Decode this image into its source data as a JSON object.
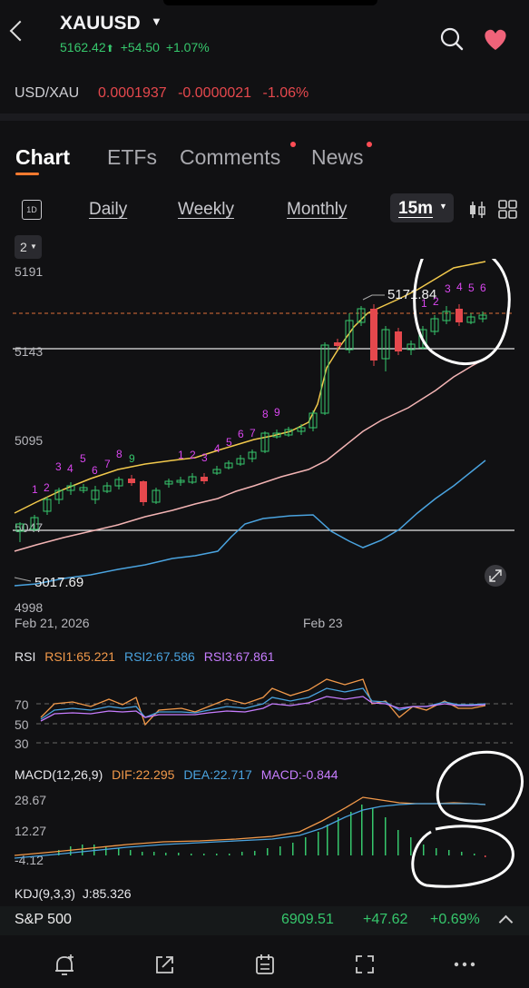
{
  "header": {
    "title": "XAUUSD",
    "price": "5162.42",
    "change": "+54.50",
    "change_pct": "+1.07%",
    "up_arrow": "⬆"
  },
  "pair": {
    "name": "USD/XAU",
    "price": "0.0001937",
    "change": "-0.0000021",
    "change_pct": "-1.06%"
  },
  "tabs": [
    {
      "label": "Chart",
      "active": true
    },
    {
      "label": "ETFs"
    },
    {
      "label": "Comments",
      "dot": true
    },
    {
      "label": "News",
      "dot": true
    }
  ],
  "periods": {
    "badge": "1D",
    "daily": "Daily",
    "weekly": "Weekly",
    "monthly": "Monthly",
    "selected": "15m"
  },
  "selector_value": "2",
  "price_axis": {
    "labels": [
      "5191",
      "5143",
      "5095",
      "5047",
      "4998"
    ]
  },
  "price_labels": {
    "high": "5171.84",
    "low": "5017.69"
  },
  "date_labels": [
    "Feb 21, 2026",
    "Feb 23"
  ],
  "seq_labels": {
    "s1": [
      "1",
      "2",
      "3",
      "4",
      "5",
      "6",
      "7",
      "8",
      "9"
    ],
    "s2": [
      "1",
      "2",
      "3",
      "4",
      "5",
      "6",
      "7",
      "8",
      "9"
    ],
    "s3": [
      "1",
      "2",
      "3",
      "4",
      "5",
      "6"
    ]
  },
  "rsi": {
    "title": "RSI",
    "rsi1": "RSI1:65.221",
    "rsi2": "RSI2:67.586",
    "rsi3": "RSI3:67.861",
    "levels": [
      "70",
      "50",
      "30"
    ]
  },
  "macd": {
    "title": "MACD(12,26,9)",
    "dif": "DIF:22.295",
    "dea": "DEA:22.717",
    "macd": "MACD:-0.844",
    "levels": [
      "28.67",
      "12.27",
      "-4.12"
    ]
  },
  "kdj": {
    "title": "KDJ(9,3,3)",
    "j": "J:85.326"
  },
  "ticker": {
    "name": "S&P 500",
    "price": "6909.51",
    "change": "+47.62",
    "change_pct": "+0.69%"
  },
  "colors": {
    "up": "#36c76c",
    "down": "#e5484d",
    "ma_yellow": "#f2c94c",
    "ma_pink": "#f3b4b4",
    "ma_blue": "#4aa3df",
    "seq_purple": "#d946ef",
    "accent": "#ff7a2f"
  }
}
